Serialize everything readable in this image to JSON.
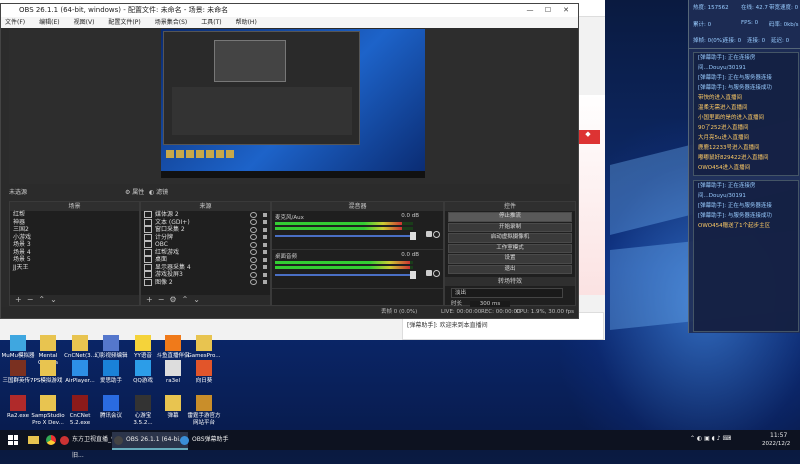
{
  "obs": {
    "title": "OBS 26.1.1 (64-bit, windows) - 配置文件: 未命名 - 场景: 未命名",
    "menu": [
      "文件(F)",
      "编辑(E)",
      "视图(V)",
      "配置文件(P)",
      "场景集合(S)",
      "工具(T)",
      "帮助(H)"
    ],
    "scene_toolbar": {
      "selected": "未选源",
      "properties": "属性",
      "filters": "滤镜"
    },
    "panels": {
      "scenes": "场景",
      "sources": "来源",
      "mixer": "混音器",
      "controls": "控件"
    },
    "scenes": [
      "红帮",
      "神器",
      "三国2",
      "小游戏",
      "场景 3",
      "场景 4",
      "场景 5",
      "JJ天王"
    ],
    "sources": [
      "媒体源 2",
      "文本 (GDI+)",
      "窗口采集 2",
      "计分牌",
      "OBC",
      "红帮游戏",
      "桌面",
      "显示器采集 4",
      "游戏投屏3",
      "图像 2"
    ],
    "mixer": [
      {
        "name": "麦克风/Aux",
        "db": "0.0 dB",
        "level": 0.92
      },
      {
        "name": "桌面音频",
        "db": "0.0 dB",
        "level": 0.98
      }
    ],
    "controls": [
      "停止推流",
      "开始录制",
      "启动虚拟摄像机",
      "工作室模式",
      "设置",
      "退出"
    ],
    "transition": {
      "header": "转场特效",
      "type": "淡出",
      "duration_label": "时长",
      "duration": "300 ms"
    },
    "status": {
      "frames": "丢帧 0 (0.0%)",
      "live": "LIVE: 00:00:00",
      "rec": "REC: 00:00:00",
      "cpu": "CPU: 1.9%, 30.00 fps"
    }
  },
  "helper": {
    "stats": [
      "热度: 157562",
      "在线: 42.7",
      "带宽速度: 0",
      "累计: 0",
      "FPS: 0",
      "码率: 0kb/s",
      "掉帧: 0(0%)",
      "连接: 0",
      "连接: 0",
      "延迟: 0"
    ],
    "log1": [
      "[弹幕助手]: 正在连接房",
      "间...Douyu/30191",
      "[弹幕助手]: 正在与服务器连接",
      "[弹幕助手]: 与服务器连接成功",
      "带快的进入直播间",
      "温柔无需进入直播间",
      "小国里面的是的进入直播间",
      "90了252进入直播间",
      "大月亮5u进入直播间",
      "鹿鹿12233号进入直播间",
      "嘟嘟鼠好829422进入直播间",
      "OWO454进入直播间"
    ],
    "log2": [
      "[弹幕助手]: 正在连接房",
      "间...Douyu/30191",
      "[弹幕助手]: 正在与服务器连接",
      "[弹幕助手]: 与服务器连接成功",
      "OWO454赠送了1个起步主区"
    ]
  },
  "browser_chat": [
    "[弹幕助手]: 欢迎来到本直播间"
  ],
  "desktop_icons": [
    [
      "MuMu模拟器",
      "Mental Omega",
      "CnCNet(3...",
      "YY语音",
      "幻影视频编辑",
      "斗鱼直播伴侣(B...",
      "GamesPro..."
    ],
    [
      "三国群英传7",
      "PS模拟游戏",
      "AirPlayer...",
      "爱思助手",
      "QQ游戏",
      "ra3el",
      "向日葵"
    ],
    [
      "Ra2.exe",
      "SampStudio Pro X Dev...",
      "CnCNet 5.2.exe",
      "腾讯会议",
      "心游宝 3.5.2...",
      "弹幕",
      "雷霆手游官方网站平台"
    ]
  ],
  "taskbar": {
    "items": [
      "东方卫视直播_怀旧...",
      "OBS 26.1.1 (64-bi...",
      "OBS弹幕助手"
    ],
    "time": "11:57",
    "date": "2022/12/2"
  }
}
